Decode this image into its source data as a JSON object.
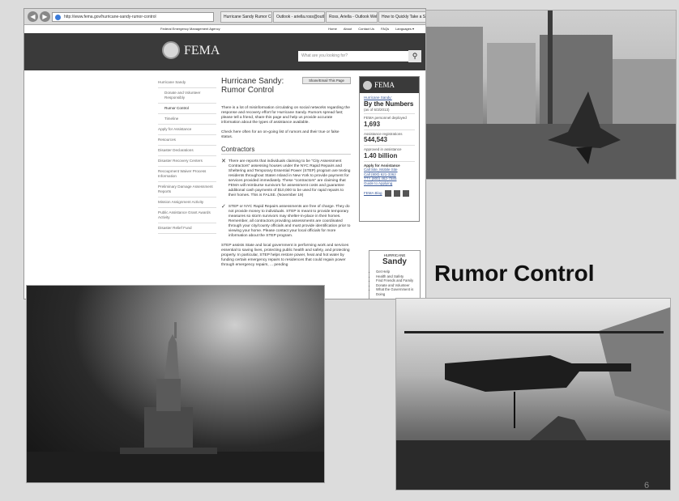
{
  "browser": {
    "url": "http://www.fema.gov/hurricane-sandy-rumor-control",
    "tabs": [
      "Hurricane Sandy Rumor Co...",
      "Outlook - ariella.ross@outlook...",
      "Ross, Ariella - Outlook Web App",
      "How to Quickly Take a Screen..."
    ]
  },
  "fema": {
    "agency": "Federal Emergency Management Agency",
    "top_links": [
      "Home",
      "About",
      "Contact Us",
      "FAQs",
      "Languages ▾"
    ],
    "brand": "FEMA",
    "search_placeholder": "What are you looking for?",
    "left_nav": [
      {
        "label": "Hurricane Sandy",
        "sub": false
      },
      {
        "label": "Donate and Volunteer Responsibly",
        "sub": true
      },
      {
        "label": "Rumor Control",
        "sub": true
      },
      {
        "label": "Timeline",
        "sub": true
      },
      {
        "label": "Apply for Assistance",
        "sub": false
      },
      {
        "label": "Resources",
        "sub": false
      },
      {
        "label": "Disaster Declarations",
        "sub": false
      },
      {
        "label": "Disaster Recovery Centers",
        "sub": false
      },
      {
        "label": "Recoupment Waiver Process Information",
        "sub": false
      },
      {
        "label": "Preliminary Damage Assessment Reports",
        "sub": false
      },
      {
        "label": "Mission Assignment Activity",
        "sub": false
      },
      {
        "label": "Public Assistance Grant Awards Activity",
        "sub": false
      },
      {
        "label": "Disaster Relief Fund",
        "sub": false
      }
    ],
    "page_title": "Hurricane Sandy: Rumor Control",
    "share_label": "Share/Email This Page",
    "intro": "There is a lot of misinformation circulating on social networks regarding the response and recovery effort for Hurricane Sandy. Rumors spread fast; please tell a friend, share this page and help us provide accurate information about the types of assistance available.",
    "check_back": "Check here often for an on-going list of rumors and their true or false status.",
    "section_heading": "Contractors",
    "rumor_false": "There are reports that individuals claiming to be \"City Assessment Contractors\" assessing houses under the NYC Rapid Repairs and Sheltering and Temporary Essential Power (STEP) program are texting residents throughout Staten Island in New York to provide payment for services provided immediately. These \"contractors\" are claiming that FEMA will reimburse survivors for assessment costs and guarantee additional cash payments of $10,000 to be used for rapid repairs to their homes. This is FALSE. (November 19)",
    "rumor_true": "STEP or NYC Rapid Repairs assessments are free of charge. They do not provide money to individuals. STEP is meant to provide temporary measures so storm survivors may shelter-in-place in their homes. Remember, all contractors providing assessments are coordinated through your city/county officials and must provide identification prior to viewing your home. Please contact your local officials for more information about the STEP program.",
    "step_para": "STEP assists State and local government in performing work and services essential to saving lives, protecting public health and safety, and protecting property. In particular, STEP helps restore power, heat and hot water by funding certain emergency repairs to residences that could regain power through emergency repairs, ... pending",
    "numbers": {
      "header": "FEMA",
      "kicker": "Hurricane Sandy:",
      "title": "By the Numbers",
      "date": "(as of 6/3/2013)",
      "stats": [
        {
          "label": "FEMA personnel deployed",
          "value": "1,693"
        },
        {
          "label": "Assistance registrations",
          "value": "544,543"
        },
        {
          "label": "Approved in assistance",
          "value": "1.40 billion"
        }
      ],
      "apply_title": "Apply for Assistance",
      "apply_links": [
        "Call Site, Mobile Site",
        "Call (800) 621-3362",
        "TTY (800) 462-7585",
        "Guide to Applying"
      ],
      "blog_link": "FEMA Blog"
    },
    "sandy_box": {
      "small": "HURRICANE",
      "big": "Sandy",
      "items": [
        "Get Help",
        "Health and Safety",
        "Find Friends and Family",
        "Donate and Volunteer",
        "What the Government is Doing"
      ]
    }
  },
  "slide": {
    "title": "Rumor Control",
    "number": "6"
  }
}
